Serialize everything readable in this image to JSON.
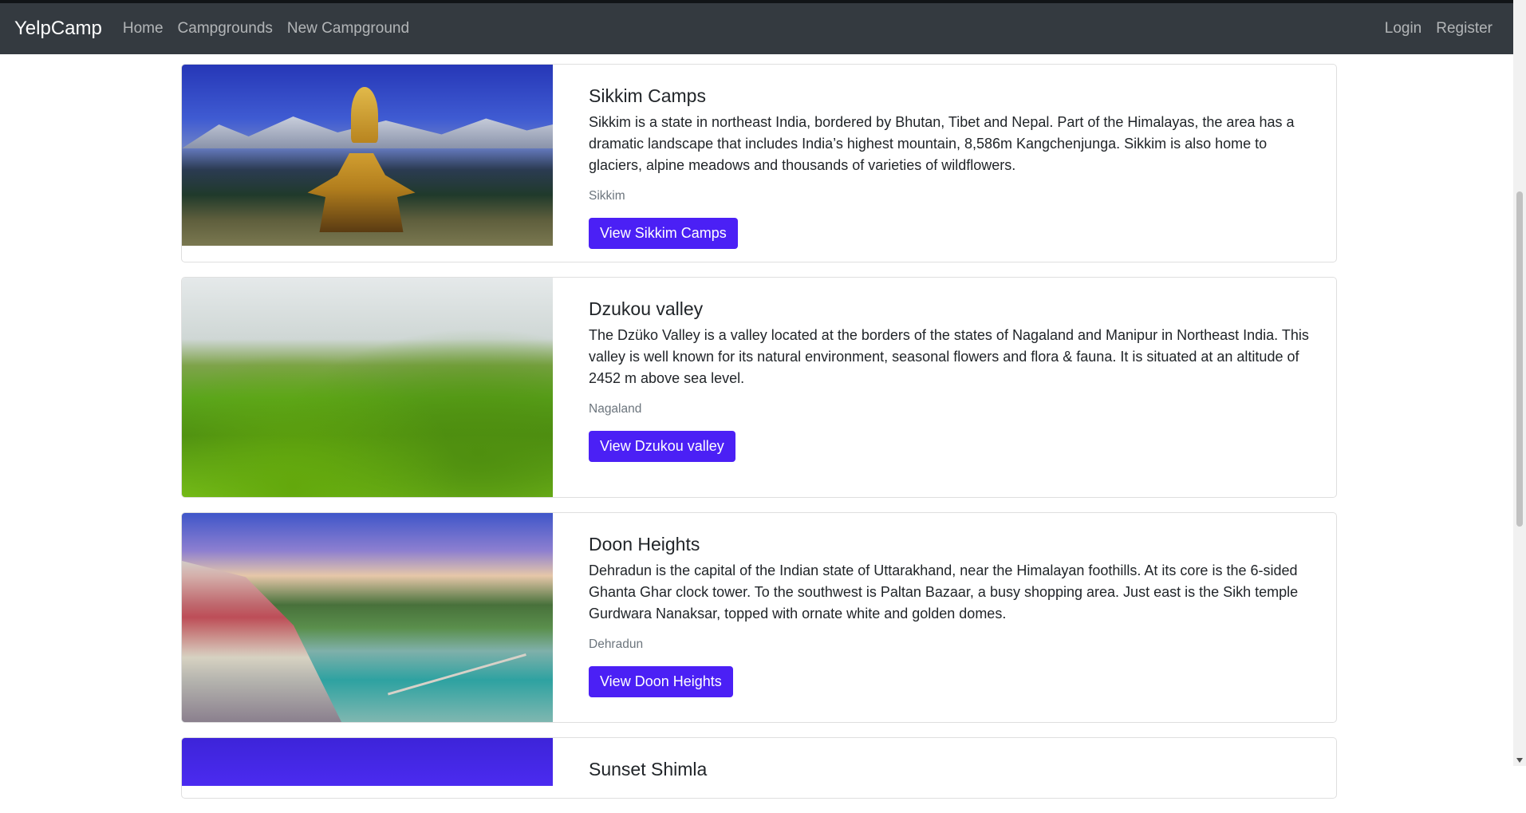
{
  "navbar": {
    "brand": "YelpCamp",
    "links": [
      "Home",
      "Campgrounds",
      "New Campground"
    ],
    "right_links": [
      "Login",
      "Register"
    ]
  },
  "campgrounds": [
    {
      "title": "Sikkim Camps",
      "description": "Sikkim is a state in northeast India, bordered by Bhutan, Tibet and Nepal. Part of the Himalayas, the area has a dramatic landscape that includes India’s highest mountain, 8,586m Kangchenjunga. Sikkim is also home to glaciers, alpine meadows and thousands of varieties of wildflowers.",
      "location": "Sikkim",
      "button": "View Sikkim Camps"
    },
    {
      "title": "Dzukou valley",
      "description": "The Dzüko Valley is a valley located at the borders of the states of Nagaland and Manipur in Northeast India. This valley is well known for its natural environment, seasonal flowers and flora & fauna. It is situated at an altitude of 2452 m above sea level.",
      "location": "Nagaland",
      "button": "View Dzukou valley"
    },
    {
      "title": "Doon Heights",
      "description": "Dehradun is the capital of the Indian state of Uttarakhand, near the Himalayan foothills. At its core is the 6-sided Ghanta Ghar clock tower. To the southwest is Paltan Bazaar, a busy shopping area. Just east is the Sikh temple Gurdwara Nanaksar, topped with ornate white and golden domes.",
      "location": "Dehradun",
      "button": "View Doon Heights"
    },
    {
      "title": "Sunset Shimla"
    }
  ],
  "colors": {
    "navbar_bg": "#343a40",
    "button_bg": "#4b20f5",
    "location_text": "#6c757d"
  }
}
